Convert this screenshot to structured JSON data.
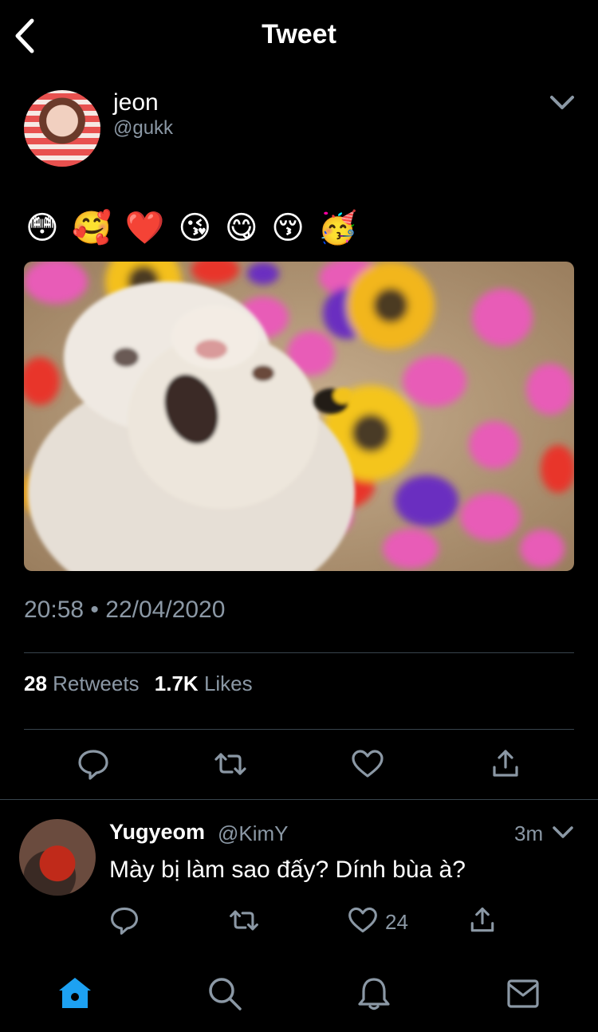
{
  "header": {
    "title": "Tweet",
    "back_icon": "chevron-left-icon"
  },
  "tweet": {
    "author_name": "jeon",
    "author_handle": "@gukk",
    "text": "😳 🥰 ❤️ 😘 😋 😚 🥳",
    "media_icon": "photo",
    "time": "20:58",
    "separator": "•",
    "date": "22/04/2020",
    "retweets_count": "28",
    "retweets_label": "Retweets",
    "likes_count": "1.7K",
    "likes_label": "Likes",
    "actions": [
      "reply-icon",
      "retweet-icon",
      "like-icon",
      "share-icon"
    ]
  },
  "reply": {
    "author_name": "Yugyeom",
    "author_handle": "@KimY",
    "time": "3m",
    "text": "Mày bị làm sao đấy? Dính bùa à?",
    "like_count": "24"
  },
  "tabbar": {
    "tabs": [
      "home-icon",
      "search-icon",
      "notifications-icon",
      "messages-icon"
    ],
    "active_color": "#1da1f2"
  },
  "colors": {
    "background": "#000000",
    "secondary_text": "#8b98a5",
    "divider": "#38444d",
    "accent": "#1da1f2"
  }
}
